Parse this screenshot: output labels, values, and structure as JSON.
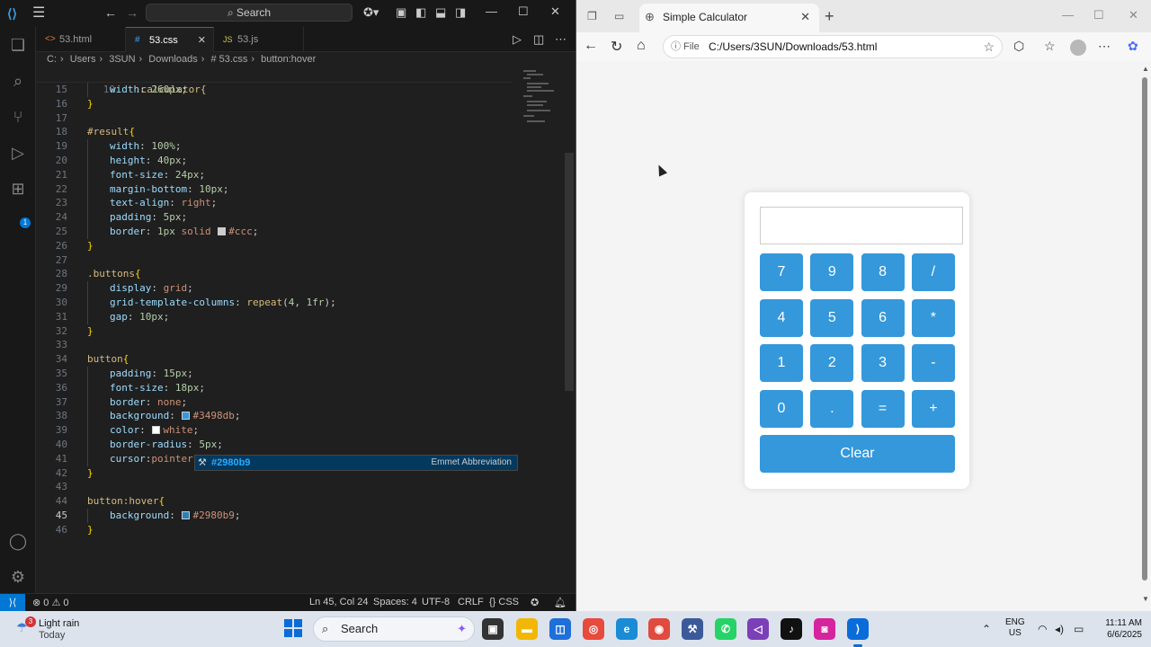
{
  "vscode": {
    "search_label": "Search",
    "tabs": [
      {
        "icon": "<>",
        "label": "53.html"
      },
      {
        "icon": "#",
        "label": "53.css"
      },
      {
        "icon": "JS",
        "label": "53.js"
      }
    ],
    "breadcrumb": [
      "C:",
      "Users",
      "3SUN",
      "Downloads",
      "# 53.css",
      "button:hover"
    ],
    "sticky_line": {
      "num": "10",
      "text": ".calculator{"
    },
    "lines": [
      {
        "num": "15",
        "parts": [
          [
            "indent",
            ""
          ],
          [
            "prop",
            "width"
          ],
          [
            "pun",
            ": "
          ],
          [
            "num",
            "260px"
          ],
          [
            "pun",
            ";"
          ]
        ]
      },
      {
        "num": "16",
        "parts": [
          [
            "br",
            "}"
          ]
        ]
      },
      {
        "num": "17",
        "parts": []
      },
      {
        "num": "18",
        "parts": [
          [
            "sel",
            "#result"
          ],
          [
            "br",
            "{"
          ]
        ]
      },
      {
        "num": "19",
        "parts": [
          [
            "indent",
            ""
          ],
          [
            "prop",
            "width"
          ],
          [
            "pun",
            ": "
          ],
          [
            "num",
            "100%"
          ],
          [
            "pun",
            ";"
          ]
        ]
      },
      {
        "num": "20",
        "parts": [
          [
            "indent",
            ""
          ],
          [
            "prop",
            "height"
          ],
          [
            "pun",
            ": "
          ],
          [
            "num",
            "40px"
          ],
          [
            "pun",
            ";"
          ]
        ]
      },
      {
        "num": "21",
        "parts": [
          [
            "indent",
            ""
          ],
          [
            "prop",
            "font-size"
          ],
          [
            "pun",
            ": "
          ],
          [
            "num",
            "24px"
          ],
          [
            "pun",
            ";"
          ]
        ]
      },
      {
        "num": "22",
        "parts": [
          [
            "indent",
            ""
          ],
          [
            "prop",
            "margin-bottom"
          ],
          [
            "pun",
            ": "
          ],
          [
            "num",
            "10px"
          ],
          [
            "pun",
            ";"
          ]
        ]
      },
      {
        "num": "23",
        "parts": [
          [
            "indent",
            ""
          ],
          [
            "prop",
            "text-align"
          ],
          [
            "pun",
            ": "
          ],
          [
            "val",
            "right"
          ],
          [
            "pun",
            ";"
          ]
        ]
      },
      {
        "num": "24",
        "parts": [
          [
            "indent",
            ""
          ],
          [
            "prop",
            "padding"
          ],
          [
            "pun",
            ": "
          ],
          [
            "num",
            "5px"
          ],
          [
            "pun",
            ";"
          ]
        ]
      },
      {
        "num": "25",
        "parts": [
          [
            "indent",
            ""
          ],
          [
            "prop",
            "border"
          ],
          [
            "pun",
            ": "
          ],
          [
            "num",
            "1px"
          ],
          [
            "val",
            " solid "
          ],
          [
            "swatch",
            "#cccccc"
          ],
          [
            "val",
            "#ccc"
          ],
          [
            "pun",
            ";"
          ]
        ]
      },
      {
        "num": "26",
        "parts": [
          [
            "br",
            "}"
          ]
        ]
      },
      {
        "num": "27",
        "parts": []
      },
      {
        "num": "28",
        "parts": [
          [
            "sel",
            ".buttons"
          ],
          [
            "br",
            "{"
          ]
        ]
      },
      {
        "num": "29",
        "parts": [
          [
            "indent",
            ""
          ],
          [
            "prop",
            "display"
          ],
          [
            "pun",
            ": "
          ],
          [
            "val",
            "grid"
          ],
          [
            "pun",
            ";"
          ]
        ]
      },
      {
        "num": "30",
        "parts": [
          [
            "indent",
            ""
          ],
          [
            "prop",
            "grid-template-columns"
          ],
          [
            "pun",
            ": "
          ],
          [
            "sel",
            "repeat"
          ],
          [
            "pun",
            "("
          ],
          [
            "num",
            "4"
          ],
          [
            "pun",
            ", "
          ],
          [
            "num",
            "1fr"
          ],
          [
            "pun",
            ");"
          ]
        ]
      },
      {
        "num": "31",
        "parts": [
          [
            "indent",
            ""
          ],
          [
            "prop",
            "gap"
          ],
          [
            "pun",
            ": "
          ],
          [
            "num",
            "10px"
          ],
          [
            "pun",
            ";"
          ]
        ]
      },
      {
        "num": "32",
        "parts": [
          [
            "br",
            "}"
          ]
        ]
      },
      {
        "num": "33",
        "parts": []
      },
      {
        "num": "34",
        "parts": [
          [
            "sel",
            "button"
          ],
          [
            "br",
            "{"
          ]
        ]
      },
      {
        "num": "35",
        "parts": [
          [
            "indent",
            ""
          ],
          [
            "prop",
            "padding"
          ],
          [
            "pun",
            ": "
          ],
          [
            "num",
            "15px"
          ],
          [
            "pun",
            ";"
          ]
        ]
      },
      {
        "num": "36",
        "parts": [
          [
            "indent",
            ""
          ],
          [
            "prop",
            "font-size"
          ],
          [
            "pun",
            ": "
          ],
          [
            "num",
            "18px"
          ],
          [
            "pun",
            ";"
          ]
        ]
      },
      {
        "num": "37",
        "parts": [
          [
            "indent",
            ""
          ],
          [
            "prop",
            "border"
          ],
          [
            "pun",
            ": "
          ],
          [
            "val",
            "none"
          ],
          [
            "pun",
            ";"
          ]
        ]
      },
      {
        "num": "38",
        "parts": [
          [
            "indent",
            ""
          ],
          [
            "prop",
            "background"
          ],
          [
            "pun",
            ": "
          ],
          [
            "swatch",
            "#3498db"
          ],
          [
            "val",
            "#3498db"
          ],
          [
            "pun",
            ";"
          ]
        ]
      },
      {
        "num": "39",
        "parts": [
          [
            "indent",
            ""
          ],
          [
            "prop",
            "color"
          ],
          [
            "pun",
            ": "
          ],
          [
            "swatch",
            "#ffffff"
          ],
          [
            "val",
            "white"
          ],
          [
            "pun",
            ";"
          ]
        ]
      },
      {
        "num": "40",
        "parts": [
          [
            "indent",
            ""
          ],
          [
            "prop",
            "border-radius"
          ],
          [
            "pun",
            ": "
          ],
          [
            "num",
            "5px"
          ],
          [
            "pun",
            ";"
          ]
        ]
      },
      {
        "num": "41",
        "parts": [
          [
            "indent",
            ""
          ],
          [
            "prop",
            "cursor"
          ],
          [
            "pun",
            ":"
          ],
          [
            "val",
            "pointer"
          ],
          [
            "pun",
            ";"
          ]
        ]
      },
      {
        "num": "42",
        "parts": [
          [
            "br",
            "}"
          ]
        ]
      },
      {
        "num": "43",
        "parts": []
      },
      {
        "num": "44",
        "parts": [
          [
            "sel",
            "button:hover"
          ],
          [
            "br",
            "{"
          ]
        ]
      },
      {
        "num": "45",
        "parts": [
          [
            "indent",
            ""
          ],
          [
            "prop",
            "background"
          ],
          [
            "pun",
            ": "
          ],
          [
            "swatch",
            "#2980b9"
          ],
          [
            "val",
            "#2980b9"
          ],
          [
            "pun",
            ";"
          ]
        ],
        "current": true
      },
      {
        "num": "46",
        "parts": [
          [
            "br",
            "}"
          ]
        ]
      }
    ],
    "suggestion": {
      "value": "#2980b9",
      "detail": "Emmet Abbreviation"
    },
    "status": {
      "errors": "0",
      "warnings": "0",
      "position": "Ln 45, Col 24",
      "spaces": "Spaces: 4",
      "encoding": "UTF-8",
      "eol": "CRLF",
      "language": "{} CSS"
    }
  },
  "browser": {
    "tab_title": "Simple Calculator",
    "address_prefix": "File",
    "url": "C:/Users/3SUN/Downloads/53.html",
    "calculator": {
      "display_value": "",
      "buttons": [
        "7",
        "9",
        "8",
        "/",
        "4",
        "5",
        "6",
        "*",
        "1",
        "2",
        "3",
        "-",
        "0",
        ".",
        "=",
        "+"
      ],
      "clear_label": "Clear",
      "button_color": "#3498db"
    }
  },
  "taskbar": {
    "weather_badge": "3",
    "weather_line1": "Light rain",
    "weather_line2": "Today",
    "search_label": "Search",
    "lang_line1": "ENG",
    "lang_line2": "US",
    "time": "11:11 AM",
    "date": "6/6/2025"
  }
}
